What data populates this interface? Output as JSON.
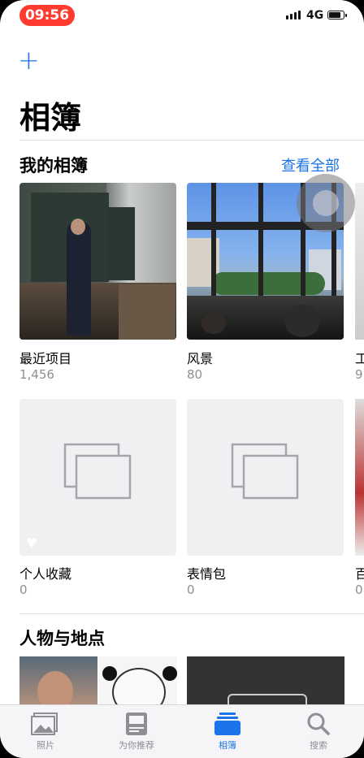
{
  "status_bar": {
    "time": "09:56",
    "network": "4G",
    "battery_level": 0.85
  },
  "header": {
    "title": "相簿"
  },
  "my_albums": {
    "title": "我的相簿",
    "see_all": "查看全部",
    "albums": [
      {
        "label": "最近项目",
        "count": "1,456"
      },
      {
        "label": "风景",
        "count": "80"
      },
      {
        "label": "个人收藏",
        "count": "0"
      },
      {
        "label": "表情包",
        "count": "0"
      }
    ],
    "peek_labels": [
      "工",
      "9",
      "百",
      "0"
    ]
  },
  "people_places": {
    "title": "人物与地点"
  },
  "tabbar": {
    "tabs": [
      {
        "label": "照片",
        "icon": "photos-icon"
      },
      {
        "label": "为你推荐",
        "icon": "for-you-icon"
      },
      {
        "label": "相簿",
        "icon": "albums-icon",
        "active": true
      },
      {
        "label": "搜索",
        "icon": "search-icon"
      }
    ]
  },
  "colors": {
    "accent": "#1a73e8",
    "recording": "#ff3b30"
  }
}
